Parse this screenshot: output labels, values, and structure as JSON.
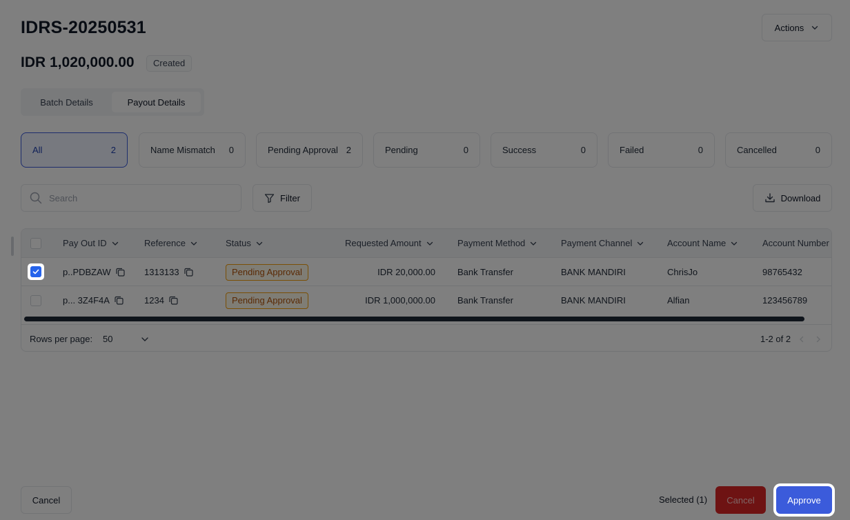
{
  "header": {
    "title": "IDRS-20250531",
    "actions_label": "Actions",
    "amount": "IDR 1,020,000.00",
    "status_badge": "Created"
  },
  "tabs": [
    {
      "label": "Batch Details",
      "active": false
    },
    {
      "label": "Payout Details",
      "active": true
    }
  ],
  "status_filters": [
    {
      "label": "All",
      "count": "2",
      "active": true
    },
    {
      "label": "Name Mismatch",
      "count": "0"
    },
    {
      "label": "Pending Approval",
      "count": "2"
    },
    {
      "label": "Pending",
      "count": "0"
    },
    {
      "label": "Success",
      "count": "0"
    },
    {
      "label": "Failed",
      "count": "0"
    },
    {
      "label": "Cancelled",
      "count": "0"
    }
  ],
  "toolbar": {
    "search_placeholder": "Search",
    "filter_label": "Filter",
    "download_label": "Download"
  },
  "table": {
    "columns": [
      "Pay Out ID",
      "Reference",
      "Status",
      "Requested Amount",
      "Payment Method",
      "Payment Channel",
      "Account Name",
      "Account Number"
    ],
    "rows": [
      {
        "checked": true,
        "payout_id": "p..PDBZAW",
        "reference": "1313133",
        "status": "Pending Approval",
        "amount": "IDR 20,000.00",
        "method": "Bank Transfer",
        "channel": "BANK MANDIRI",
        "account_name": "ChrisJo",
        "account_number": "98765432"
      },
      {
        "checked": false,
        "payout_id": "p... 3Z4F4A",
        "reference": "1234",
        "status": "Pending Approval",
        "amount": "IDR 1,000,000.00",
        "method": "Bank Transfer",
        "channel": "BANK MANDIRI",
        "account_name": "Alfian",
        "account_number": "123456789"
      }
    ]
  },
  "pagination": {
    "rows_per_page_label": "Rows per page:",
    "rows_per_page_value": "50",
    "range": "1-2 of 2"
  },
  "footer": {
    "cancel_label": "Cancel",
    "selected_text": "Selected (1)",
    "cancel_danger_label": "Cancel",
    "approve_label": "Approve"
  },
  "colors": {
    "accent": "#3b5bdb",
    "danger": "#dc2626",
    "pending_border": "#f59e0b",
    "pending_text": "#b45309"
  }
}
